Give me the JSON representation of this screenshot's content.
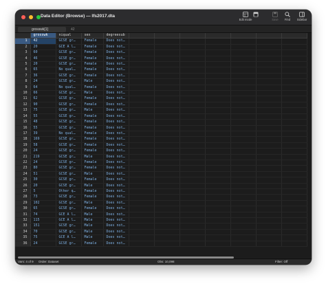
{
  "window": {
    "title": "Data Editor (Browse) — lfs2017.dta",
    "traffic_lights": {
      "close": "#ff5f57",
      "minimize": "#febc2e",
      "zoom": "#28c840"
    }
  },
  "toolbar": {
    "edit_mode": {
      "label": "Edit mode",
      "icon": "edit-mode-icon"
    },
    "unknown": {
      "label": "",
      "icon": "table-edit-icon"
    },
    "save": {
      "label": "Save",
      "icon": "save-icon"
    },
    "find": {
      "label": "Find",
      "icon": "search-icon"
    },
    "sidebar": {
      "label": "Sidebar",
      "icon": "sidebar-icon"
    }
  },
  "cell_editor": {
    "cell_name": "grosswk[1]",
    "value": "42"
  },
  "grid": {
    "columns": [
      "grosswk",
      "niqual",
      "sex",
      "degreesub"
    ],
    "rows": [
      [
        "1",
        "42",
        "GCSE gr…",
        "Female",
        "Does not…"
      ],
      [
        "2",
        "20",
        "GCE A l…",
        "Female",
        "Does not…"
      ],
      [
        "3",
        "60",
        "GCSE gr…",
        "Female",
        "Does not…"
      ],
      [
        "4",
        "46",
        "GCSE gr…",
        "Female",
        "Does not…"
      ],
      [
        "5",
        "20",
        "GCSE gr…",
        "Female",
        "Does not…"
      ],
      [
        "6",
        "65",
        "No qual…",
        "Female",
        "Does not…"
      ],
      [
        "7",
        "36",
        "GCSE gr…",
        "Female",
        "Does not…"
      ],
      [
        "8",
        "24",
        "GCSE gr…",
        "Male",
        "Does not…"
      ],
      [
        "9",
        "64",
        "No qual…",
        "Female",
        "Does not…"
      ],
      [
        "10",
        "66",
        "GCSE gr…",
        "Male",
        "Does not…"
      ],
      [
        "11",
        "62",
        "GCSE gr…",
        "Female",
        "Does not…"
      ],
      [
        "12",
        "90",
        "GCSE gr…",
        "Female",
        "Does not…"
      ],
      [
        "13",
        "75",
        "GCSE gr…",
        "Male",
        "Does not…"
      ],
      [
        "14",
        "55",
        "GCSE gr…",
        "Female",
        "Does not…"
      ],
      [
        "15",
        "48",
        "GCSE gr…",
        "Female",
        "Does not…"
      ],
      [
        "16",
        "55",
        "GCSE gr…",
        "Female",
        "Does not…"
      ],
      [
        "17",
        "39",
        "No qual…",
        "Female",
        "Does not…"
      ],
      [
        "18",
        "169",
        "GCSE gr…",
        "Female",
        "Does not…"
      ],
      [
        "19",
        "58",
        "GCSE gr…",
        "Female",
        "Does not…"
      ],
      [
        "20",
        "24",
        "GCSE gr…",
        "Female",
        "Does not…"
      ],
      [
        "21",
        "219",
        "GCSE gr…",
        "Male",
        "Does not…"
      ],
      [
        "22",
        "24",
        "GCSE gr…",
        "Female",
        "Does not…"
      ],
      [
        "23",
        "80",
        "GCSE gr…",
        "Female",
        "Does not…"
      ],
      [
        "24",
        "51",
        "GCSE gr…",
        "Male",
        "Does not…"
      ],
      [
        "25",
        "30",
        "GCSE gr…",
        "Female",
        "Does not…"
      ],
      [
        "26",
        "20",
        "GCSE gr…",
        "Male",
        "Does not…"
      ],
      [
        "27",
        "5",
        "Other q…",
        "Female",
        "Does not…"
      ],
      [
        "28",
        "73",
        "GCSE gr…",
        "Female",
        "Does not…"
      ],
      [
        "29",
        "102",
        "GCSE gr…",
        "Male",
        "Does not…"
      ],
      [
        "30",
        "65",
        "GCSE gr…",
        "Female",
        "Does not…"
      ],
      [
        "31",
        "74",
        "GCE A l…",
        "Male",
        "Does not…"
      ],
      [
        "32",
        "115",
        "GCE A l…",
        "Male",
        "Does not…"
      ],
      [
        "33",
        "151",
        "GCSE gr…",
        "Male",
        "Does not…"
      ],
      [
        "34",
        "70",
        "GCSE gr…",
        "Male",
        "Does not…"
      ],
      [
        "35",
        "75",
        "GCE A l…",
        "Male",
        "Does not…"
      ],
      [
        "36",
        "24",
        "GCSE gr…",
        "Female",
        "Does not…"
      ]
    ]
  },
  "status": {
    "vars": "Vars: 4 of 9",
    "order": "Order: Dataset",
    "obs": "Obs: 10,098",
    "filter": "Filter: Off"
  },
  "colors": {
    "background": "#1e1e1e",
    "cell_text": "#7fb2e5",
    "selection": "#3a5a82"
  }
}
